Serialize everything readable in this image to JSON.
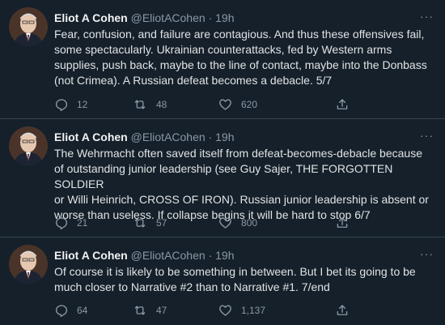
{
  "tweets": [
    {
      "name": "Eliot A Cohen",
      "handle": "@EliotACohen",
      "separator": "·",
      "time": "19h",
      "more": "···",
      "lines": [
        "Fear, confusion, and failure are contagious. And thus these offensives fail,",
        "some spectacularly. Ukrainian counterattacks, fed by Western arms",
        "supplies, push back, maybe to the line of contact, maybe into the Donbass",
        "(not Crimea). A Russian defeat becomes a debacle. 5/7"
      ],
      "replies": "12",
      "retweets": "48",
      "likes": "620"
    },
    {
      "name": "Eliot A Cohen",
      "handle": "@EliotACohen",
      "separator": "·",
      "time": "19h",
      "more": "···",
      "lines": [
        "The Wehrmacht often saved itself from defeat-becomes-debacle because",
        "of outstanding junior leadership (see Guy Sajer, THE FORGOTTEN SOLDIER",
        "or Willi Heinrich, CROSS OF IRON). Russian junior leadership is absent or",
        "worse than useless. If collapse begins it will be hard to stop 6/7"
      ],
      "replies": "21",
      "retweets": "57",
      "likes": "800"
    },
    {
      "name": "Eliot A Cohen",
      "handle": "@EliotACohen",
      "separator": "·",
      "time": "19h",
      "more": "···",
      "lines": [
        "Of course it is likely to be something in between.  But I bet its going to be",
        "much closer to Narrative #2 than to Narrative #1. 7/end"
      ],
      "replies": "64",
      "retweets": "47",
      "likes": "1,137"
    }
  ],
  "icons": {
    "reply": "reply-icon",
    "retweet": "retweet-icon",
    "like": "heart-icon",
    "share": "share-icon",
    "more": "more-icon"
  },
  "colors": {
    "background": "#15202b",
    "divider": "#38444d",
    "text": "#e1e3e4",
    "muted": "#8b98a5"
  }
}
